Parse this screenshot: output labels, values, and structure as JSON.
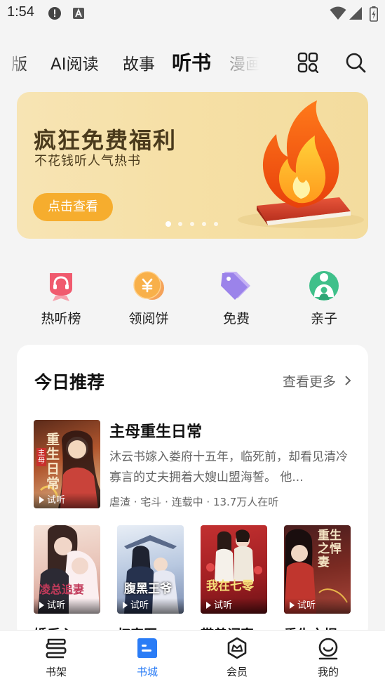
{
  "status_bar": {
    "time": "1:54"
  },
  "top_nav": {
    "tabs": [
      {
        "label": "版"
      },
      {
        "label": "AI阅读"
      },
      {
        "label": "故事"
      },
      {
        "label": "听书"
      },
      {
        "label": "漫画"
      }
    ],
    "active_tab": "听书"
  },
  "banner": {
    "title": "疯狂免费福利",
    "subtitle": "不花钱听人气热书",
    "button_label": "点击查看",
    "page_count": 5,
    "active_page": 1
  },
  "quick_links": [
    {
      "label": "热听榜",
      "icon": "headphones-badge-icon"
    },
    {
      "label": "领阅饼",
      "icon": "coin-icon"
    },
    {
      "label": "免费",
      "icon": "price-tag-icon"
    },
    {
      "label": "亲子",
      "icon": "parent-child-icon"
    }
  ],
  "recommend": {
    "title": "今日推荐",
    "more_label": "查看更多",
    "featured": {
      "title": "主母重生日常",
      "description": "沐云书嫁入娄府十五年，临死前，却看见清冷寡言的丈夫拥着大嫂山盟海誓。 他...",
      "meta": "虐渣 · 宅斗 · 连载中 · 13.7万人在听",
      "trial_label": "试听",
      "cover_text": "重生日常",
      "cover_badge": "主母"
    },
    "books": [
      {
        "title": "婚后心",
        "trial_label": "试听",
        "cover_text": "凌总追妻"
      },
      {
        "title": "权宠医",
        "trial_label": "试听",
        "cover_text": "腹黑王爷"
      },
      {
        "title": "带着词家",
        "trial_label": "试听",
        "cover_text": "我在七零"
      },
      {
        "title": "重生之悍",
        "trial_label": "试听",
        "cover_text": "重生之悍妻"
      }
    ]
  },
  "bottom_nav": {
    "items": [
      {
        "label": "书架",
        "icon": "bookshelf-icon"
      },
      {
        "label": "书城",
        "icon": "bookstore-icon"
      },
      {
        "label": "会员",
        "icon": "vip-crown-icon"
      },
      {
        "label": "我的",
        "icon": "profile-smile-icon"
      }
    ],
    "active": "书城",
    "accent_color": "#2a7cf6"
  }
}
